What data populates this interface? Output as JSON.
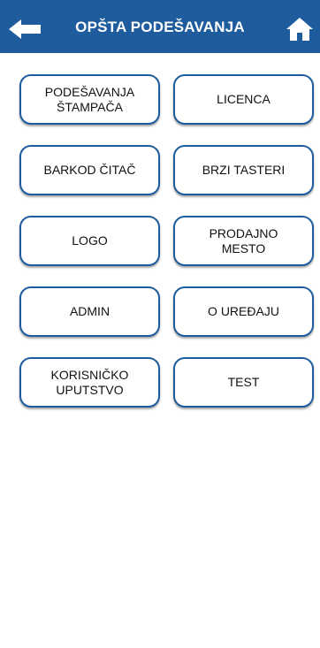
{
  "header": {
    "title": "OPŠTA PODEŠAVANJA",
    "back_icon": "arrow-left-icon",
    "home_icon": "home-icon",
    "color": "#1f5c9e"
  },
  "tiles": [
    {
      "label": "PODEŠAVANJA\nŠTAMPAČA"
    },
    {
      "label": "LICENCA"
    },
    {
      "label": "BARKOD ČITAČ"
    },
    {
      "label": "BRZI TASTERI"
    },
    {
      "label": "LOGO"
    },
    {
      "label": "PRODAJNO\nMESTO"
    },
    {
      "label": "ADMIN"
    },
    {
      "label": "O UREĐAJU"
    },
    {
      "label": "KORISNIČKO\nUPUTSTVO"
    },
    {
      "label": "TEST"
    }
  ]
}
